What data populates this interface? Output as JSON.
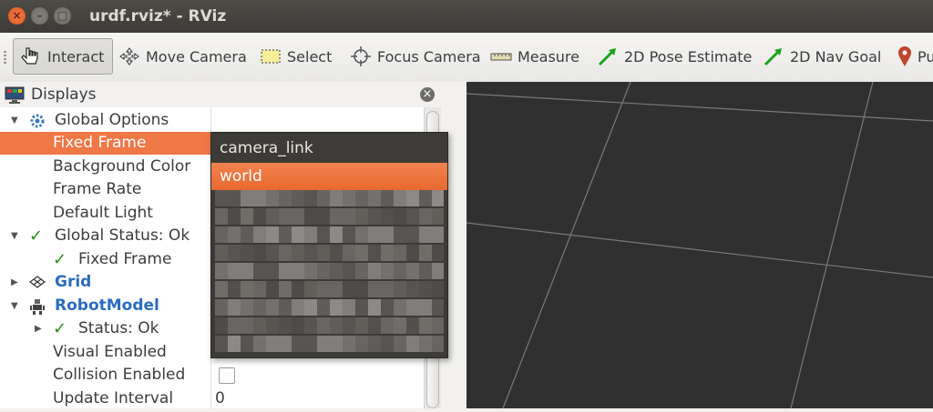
{
  "window": {
    "title": "urdf.rviz* - RViz",
    "close_glyph": "×",
    "min_glyph": "–",
    "max_glyph": "□"
  },
  "toolbar": {
    "tools": [
      {
        "label": "Interact",
        "icon": "hand-pointer-icon",
        "active": true
      },
      {
        "label": "Move Camera",
        "icon": "move-camera-icon"
      },
      {
        "label": "Select",
        "icon": "select-box-icon"
      },
      {
        "label": "Focus Camera",
        "icon": "crosshair-icon"
      },
      {
        "label": "Measure",
        "icon": "ruler-icon"
      },
      {
        "label": "2D Pose Estimate",
        "icon": "green-arrow-icon"
      },
      {
        "label": "2D Nav Goal",
        "icon": "green-arrow-icon"
      },
      {
        "label": "Pu",
        "icon": "map-pin-icon"
      }
    ]
  },
  "displays": {
    "title": "Displays",
    "close_glyph": "×",
    "rows": [
      {
        "label": "Global Options"
      },
      {
        "label": "Fixed Frame"
      },
      {
        "label": "Background Color"
      },
      {
        "label": "Frame Rate"
      },
      {
        "label": "Default Light"
      },
      {
        "label": "Global Status: Ok"
      },
      {
        "label": "Fixed Frame"
      },
      {
        "label": "Grid"
      },
      {
        "label": "RobotModel"
      },
      {
        "label": "Status: Ok"
      },
      {
        "label": "Visual Enabled"
      },
      {
        "label": "Collision Enabled"
      },
      {
        "label": "Update Interval",
        "value": "0"
      }
    ]
  },
  "fixed_frame_dropdown": {
    "options": [
      "camera_link",
      "world"
    ],
    "selected": "world"
  },
  "colors": {
    "accent": "#f07746",
    "view_bg": "#303030",
    "check": "#2b8a1f",
    "link_blue": "#2a6cc0"
  }
}
